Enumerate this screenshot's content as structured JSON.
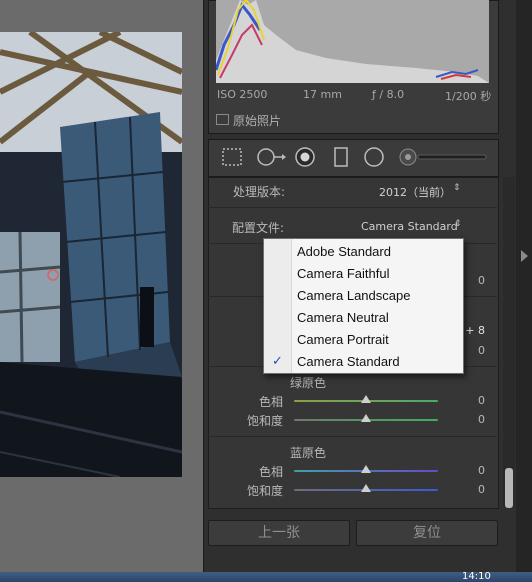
{
  "histogram": {
    "iso": "ISO 2500",
    "focal_length": "17 mm",
    "aperture": "ƒ / 8.0",
    "shutter": "1/200 秒",
    "original_photo_label": "原始照片"
  },
  "basic": {
    "process_label": "处理版本:",
    "process_value": "2012（当前）",
    "profile_label": "配置文件:",
    "profile_value": "Camera Standard"
  },
  "profile_menu": {
    "items": [
      "Adobe Standard",
      "Camera Faithful",
      "Camera Landscape",
      "Camera Neutral",
      "Camera Portrait",
      "Camera Standard"
    ],
    "selected": "Camera Standard",
    "check_glyph": "✓"
  },
  "calibration": {
    "partial_values": {
      "upper_value": "0",
      "mid_value": "+ 8",
      "lower_value": "0"
    },
    "green": {
      "title": "绿原色",
      "hue_label": "色相",
      "hue_value": "0",
      "sat_label": "饱和度",
      "sat_value": "0"
    },
    "blue": {
      "title": "蓝原色",
      "hue_label": "色相",
      "hue_value": "0",
      "sat_label": "饱和度",
      "sat_value": "0"
    }
  },
  "buttons": {
    "previous": "上一张",
    "reset": "复位"
  },
  "taskbar": {
    "clock": "14:10"
  },
  "colors": {
    "panel": "#363636",
    "menu_bg": "#f5f5f5",
    "check": "#2a4fa8",
    "green_track": "#6aa84f",
    "blue_track": "#5a68c8"
  },
  "icons": [
    "crop-icon",
    "spot-removal-icon",
    "red-eye-icon",
    "graduated-filter-icon",
    "radial-filter-icon",
    "adjustment-brush-icon",
    "check-icon",
    "expand-arrow-icon"
  ]
}
